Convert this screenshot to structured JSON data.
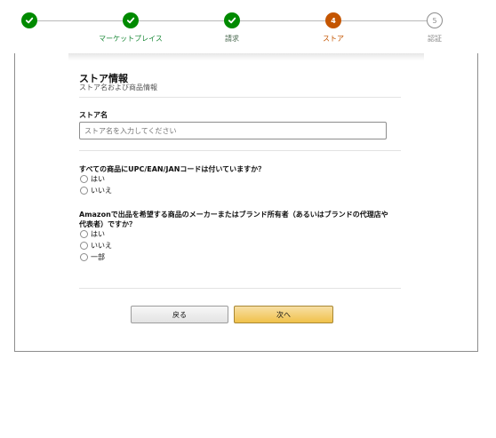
{
  "stepper": {
    "steps": [
      {
        "number": "",
        "label": "",
        "state": "done"
      },
      {
        "number": "",
        "label": "マーケットプレイス",
        "state": "done"
      },
      {
        "number": "",
        "label": "請求",
        "state": "done"
      },
      {
        "number": "4",
        "label": "ストア",
        "state": "current"
      },
      {
        "number": "5",
        "label": "認証",
        "state": "todo"
      }
    ]
  },
  "form": {
    "title": "ストア情報",
    "subtitle": "ストア名および商品情報",
    "store_name_label": "ストア名",
    "store_name_placeholder": "ストア名を入力してください",
    "store_name_value": "",
    "q1": {
      "text": "すべての商品にUPC/EAN/JANコードは付いていますか？",
      "options": [
        "はい",
        "いいえ"
      ]
    },
    "q2": {
      "text_line1": "Amazonで出品を希望する商品のメーカーまたはブランド所有者（あるいはブランドの代理店や",
      "text_line2": "代表者）ですか？",
      "options": [
        "はい",
        "いいえ",
        "一部"
      ]
    },
    "back_label": "戻る",
    "next_label": "次へ"
  },
  "colors": {
    "done": "#008a00",
    "current": "#c45500",
    "next_button": "#f0c14b"
  }
}
